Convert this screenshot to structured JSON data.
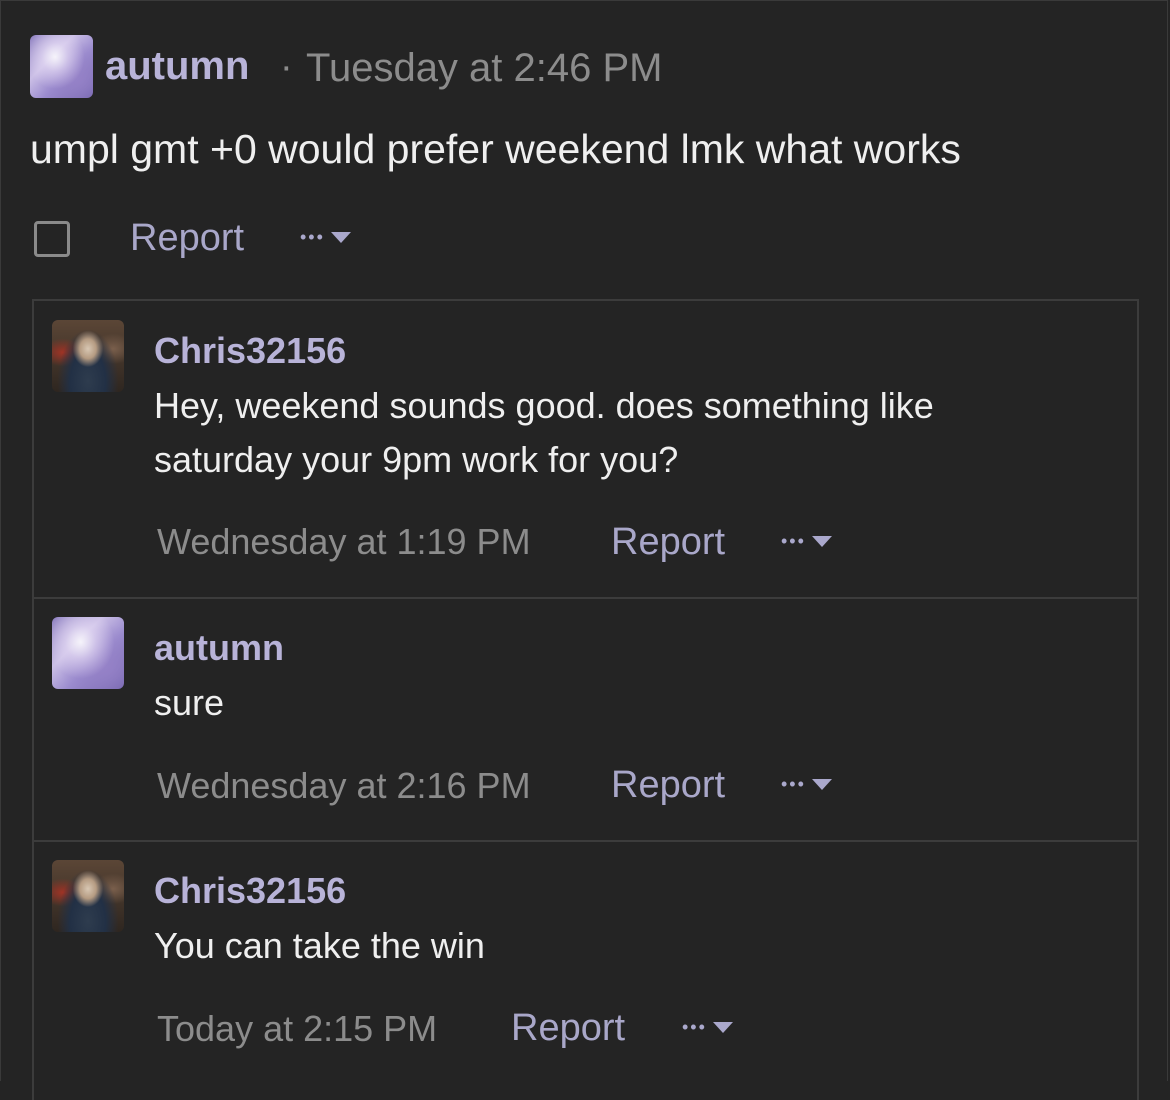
{
  "post": {
    "author": "autumn",
    "separator": "·",
    "timestamp": "Tuesday at 2:46 PM",
    "text": "umpl gmt +0 would prefer weekend lmk what works",
    "report_label": "Report",
    "more_label": "•••"
  },
  "replies": [
    {
      "author": "Chris32156",
      "text_line1": "Hey, weekend sounds good. does something like",
      "text_line2": "saturday your 9pm work for you?",
      "timestamp": "Wednesday at 1:19 PM",
      "report_label": "Report",
      "more_label": "•••"
    },
    {
      "author": "autumn",
      "text_line1": "sure",
      "timestamp": "Wednesday at 2:16 PM",
      "report_label": "Report",
      "more_label": "•••"
    },
    {
      "author": "Chris32156",
      "text_line1": "You can take the win",
      "timestamp": "Today at 2:15 PM",
      "report_label": "Report",
      "more_label": "•••"
    }
  ],
  "colors": {
    "background": "#242424",
    "username": "#b8b3d8",
    "link": "#a9a7c9",
    "muted": "#8c8c8c",
    "text": "#efefef"
  }
}
